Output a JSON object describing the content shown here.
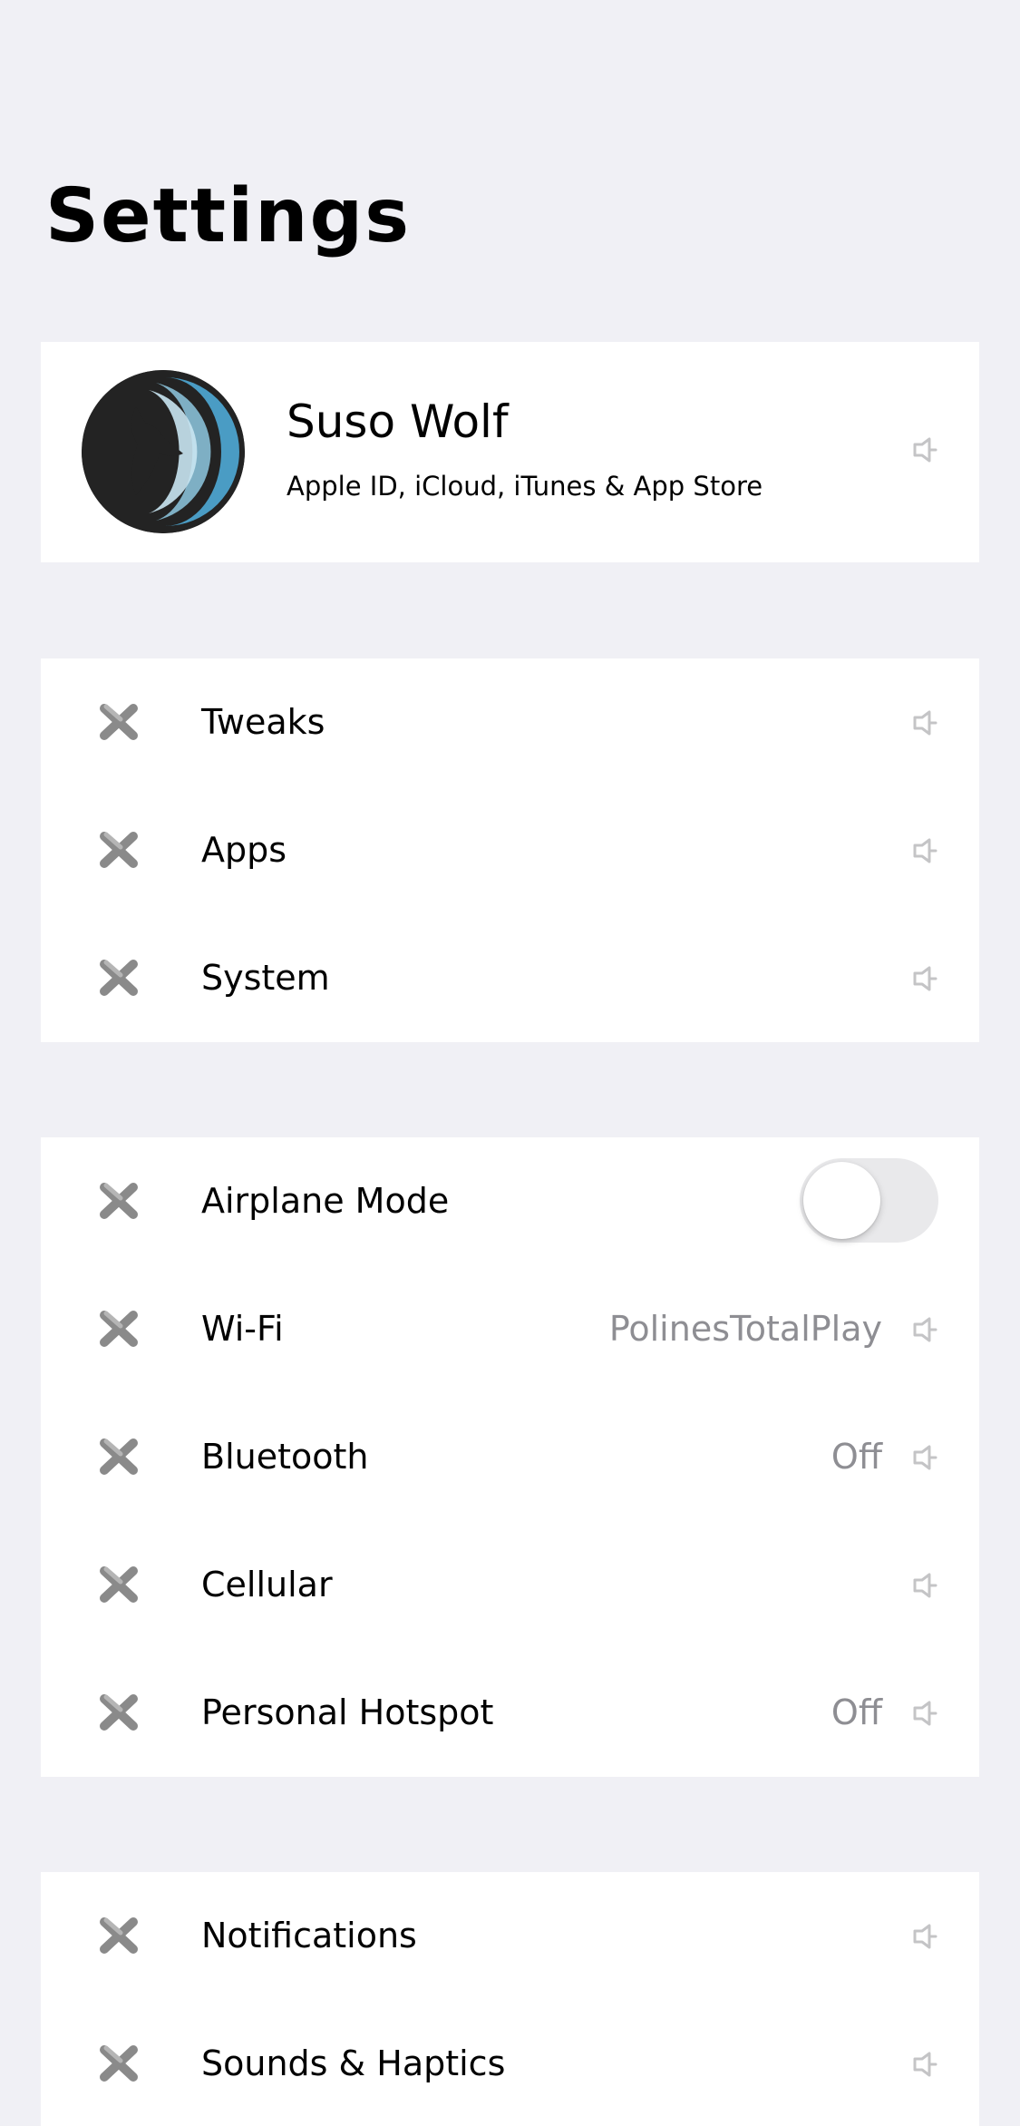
{
  "header": {
    "title": "Settings"
  },
  "profile": {
    "name": "Suso Wolf",
    "subtitle": "Apple ID, iCloud, iTunes & App Store",
    "avatar_icon": "fox-avatar-icon"
  },
  "colors": {
    "background": "#f0f0f5",
    "card": "#ffffff",
    "secondary_text": "#8e8e93",
    "icon_gray": "#8a8a8a",
    "toggle_off": "#e9e9eb",
    "avatar_blue": "#4a9cc4"
  },
  "groups": [
    {
      "items": [
        {
          "label": "Tweaks",
          "icon": "placeholder-x-icon",
          "accessory": "chevron"
        },
        {
          "label": "Apps",
          "icon": "placeholder-x-icon",
          "accessory": "chevron"
        },
        {
          "label": "System",
          "icon": "placeholder-x-icon",
          "accessory": "chevron"
        }
      ]
    },
    {
      "items": [
        {
          "label": "Airplane Mode",
          "icon": "placeholder-x-icon",
          "accessory": "toggle",
          "toggle_on": false
        },
        {
          "label": "Wi-Fi",
          "icon": "placeholder-x-icon",
          "value": "PolinesTotalPlay",
          "accessory": "chevron"
        },
        {
          "label": "Bluetooth",
          "icon": "placeholder-x-icon",
          "value": "Off",
          "accessory": "chevron"
        },
        {
          "label": "Cellular",
          "icon": "placeholder-x-icon",
          "accessory": "chevron"
        },
        {
          "label": "Personal Hotspot",
          "icon": "placeholder-x-icon",
          "value": "Off",
          "accessory": "chevron"
        }
      ]
    },
    {
      "items": [
        {
          "label": "Notifications",
          "icon": "placeholder-x-icon",
          "accessory": "chevron"
        },
        {
          "label": "Sounds & Haptics",
          "icon": "placeholder-x-icon",
          "accessory": "chevron"
        }
      ]
    }
  ]
}
